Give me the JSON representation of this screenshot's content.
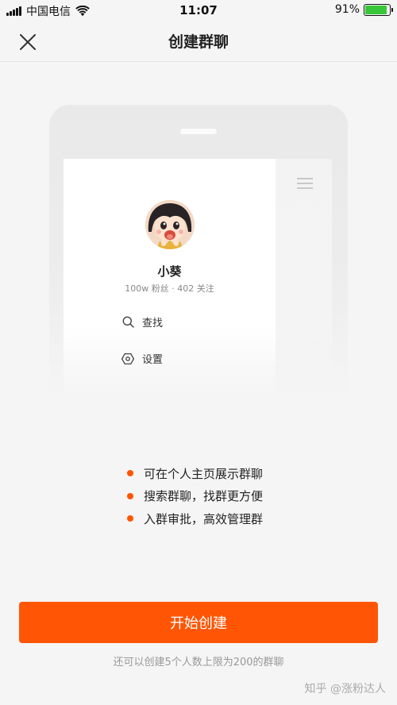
{
  "status_bar": {
    "carrier": "中国电信",
    "time": "11:07",
    "battery_percent_text": "91%",
    "battery_level": 0.91,
    "signal_icon": "signal-bars-icon",
    "wifi_icon": "wifi-icon",
    "battery_fill_color": "#3ac63a"
  },
  "nav": {
    "title": "创建群聊",
    "close_icon": "close-icon"
  },
  "preview": {
    "profile_name": "小葵",
    "profile_stats": "100w 粉丝 · 402 关注",
    "menu_icon": "hamburger-menu-icon",
    "items": [
      {
        "label": "查找",
        "icon": "search-icon"
      },
      {
        "label": "设置",
        "icon": "settings-icon"
      }
    ]
  },
  "features": [
    "可在个人主页展示群聊",
    "搜索群聊，找群更方便",
    "入群审批，高效管理群"
  ],
  "cta": {
    "label": "开始创建",
    "color": "#ff5505"
  },
  "limit_note": "还可以创建5个人数上限为200的群聊",
  "watermark": "知乎 @涨粉达人"
}
